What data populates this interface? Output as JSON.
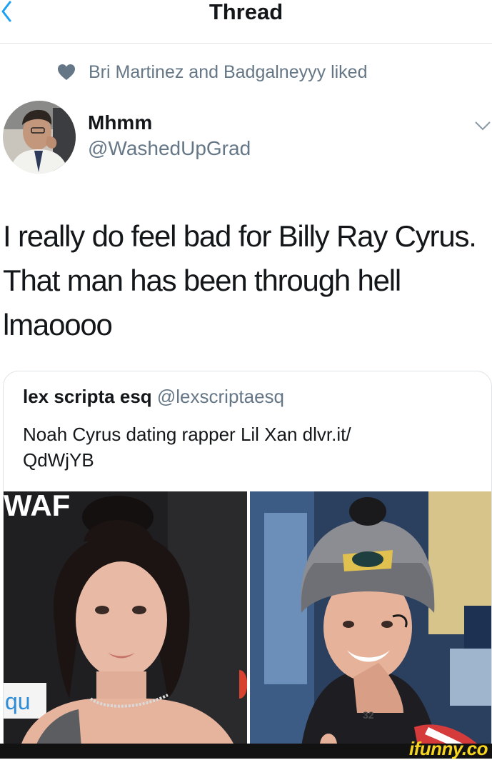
{
  "nav": {
    "title": "Thread",
    "back_icon": "chevron-left-icon"
  },
  "social_context": {
    "icon": "heart-icon",
    "text": "Bri Martinez and Badgalneyyy liked"
  },
  "author": {
    "display_name": "Mhmm",
    "handle": "@WashedUpGrad"
  },
  "tweet": {
    "lines": [
      "I really do feel bad for Billy Ray Cyrus.",
      "That man has been through hell",
      "lmaoooo"
    ]
  },
  "quoted": {
    "name": "lex scripta esq",
    "handle": "@lexscriptaesq",
    "text_lines": [
      "Noah Cyrus dating rapper Lil Xan dlvr.it/",
      "QdWjYB"
    ],
    "photo_left_sign": "WAF",
    "photo_left_sign2": "qu",
    "photo_right_tag": "32"
  },
  "watermark": "ifunny.co",
  "colors": {
    "accent": "#1da1f2",
    "muted": "#657786",
    "border": "#dfe3e6"
  }
}
